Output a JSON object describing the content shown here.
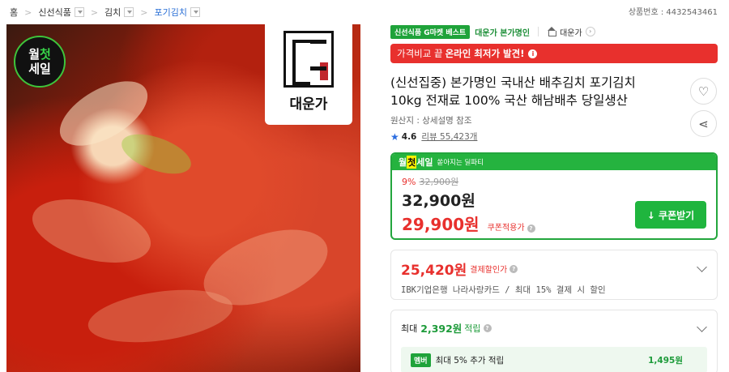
{
  "breadcrumb": {
    "home": "홈",
    "level1": "신선식품",
    "level2": "김치",
    "level3": "포기김치"
  },
  "product_number": "상품번호 : 4432543461",
  "hero": {
    "badge_line1_a": "월",
    "badge_line1_b": "첫",
    "badge_line2": "세일",
    "brand_name": "대운가"
  },
  "tags": {
    "best": "신선식품 G마켓 베스트",
    "seller": "대운가 본가명인",
    "shop": "대운가"
  },
  "notice": {
    "pre": "가격비교 끝",
    "strong": "온라인 최저가 발견!"
  },
  "title": "(신선집중) 본가명인 국내산 배추김치 포기김치 10kg 전재료 100% 국산 해남배추 당일생산",
  "origin": "원산지 : 상세설명 참조",
  "rating": {
    "score": "4.6",
    "reviews": "리뷰 55,423개"
  },
  "deal": {
    "title_a": "월",
    "title_b": "첫",
    "title_c": "세일",
    "subtitle": "쏟아지는 딜파티",
    "discount": "9%",
    "original_price": "32,900원",
    "price": "32,900원",
    "coupon_price": "29,900원",
    "coupon_label": "쿠폰적용가",
    "coupon_button": "↓ 쿠폰받기"
  },
  "card_discount": {
    "amount": "25,420원",
    "label": "결제할인가",
    "desc": "IBK기업은행 나라사랑카드 / 최대 15% 결제 시 할인"
  },
  "card_points": {
    "prefix": "최대",
    "amount": "2,392원",
    "suffix": "적립",
    "member_badge": "멤버",
    "member_text": "최대 5% 추가 적립",
    "member_amount": "1,495원"
  },
  "colors": {
    "accent_green": "#1fb53e",
    "accent_red": "#e8302d",
    "link_blue": "#2a6fd6"
  }
}
